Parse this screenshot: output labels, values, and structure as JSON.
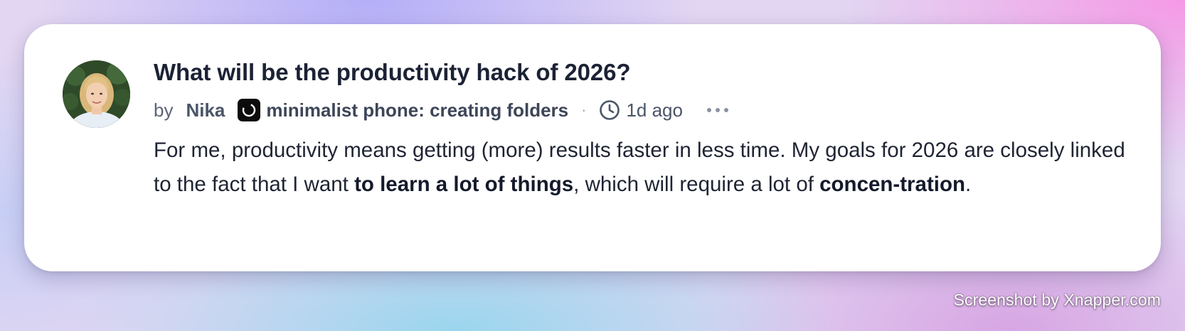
{
  "post": {
    "title": "What will be the productivity hack of 2026?",
    "by_label": "by",
    "author": "Nika",
    "publication": "minimalist phone: creating folders",
    "separator": "·",
    "time_ago": "1d ago",
    "more_label": "more-options",
    "body": {
      "part1": "For me, productivity means getting (more) results faster in less time. My goals for 2026 are closely linked to the fact that I want ",
      "bold1": "to learn a lot of things",
      "part2": ", which will require a lot of ",
      "bold2": "concen-tration",
      "part3": "."
    }
  },
  "watermark": "Screenshot by Xnapper.com",
  "icons": {
    "avatar": "avatar",
    "publication": "publication-logo-icon",
    "clock": "clock-icon",
    "more": "more-dots-icon"
  }
}
